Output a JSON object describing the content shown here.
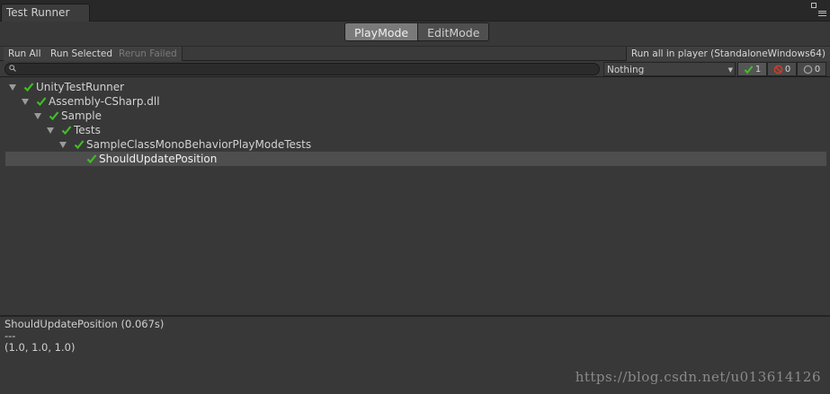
{
  "window": {
    "tab_title": "Test Runner"
  },
  "modes": {
    "playmode_label": "PlayMode",
    "editmode_label": "EditMode"
  },
  "toolbar": {
    "run_all": "Run All",
    "run_selected": "Run Selected",
    "rerun_failed": "Rerun Failed",
    "run_in_player": "Run all in player (StandaloneWindows64)"
  },
  "filter": {
    "search_value": "",
    "category_selected": "Nothing",
    "passed_count": "1",
    "failed_count": "0",
    "skipped_count": "0"
  },
  "tree": {
    "items": [
      {
        "label": "UnityTestRunner",
        "status": "passed"
      },
      {
        "label": "Assembly-CSharp.dll",
        "status": "passed"
      },
      {
        "label": "Sample",
        "status": "passed"
      },
      {
        "label": "Tests",
        "status": "passed"
      },
      {
        "label": "SampleClassMonoBehaviorPlayModeTests",
        "status": "passed"
      },
      {
        "label": "ShouldUpdatePosition",
        "status": "passed"
      }
    ]
  },
  "details": {
    "line1": "ShouldUpdatePosition (0.067s)",
    "line2": "---",
    "line3": "(1.0, 1.0, 1.0)"
  },
  "watermark": "https://blog.csdn.net/u013614126",
  "colors": {
    "pass_green": "#3fbf23",
    "fail_red": "#d23b2b",
    "background": "#383838"
  }
}
